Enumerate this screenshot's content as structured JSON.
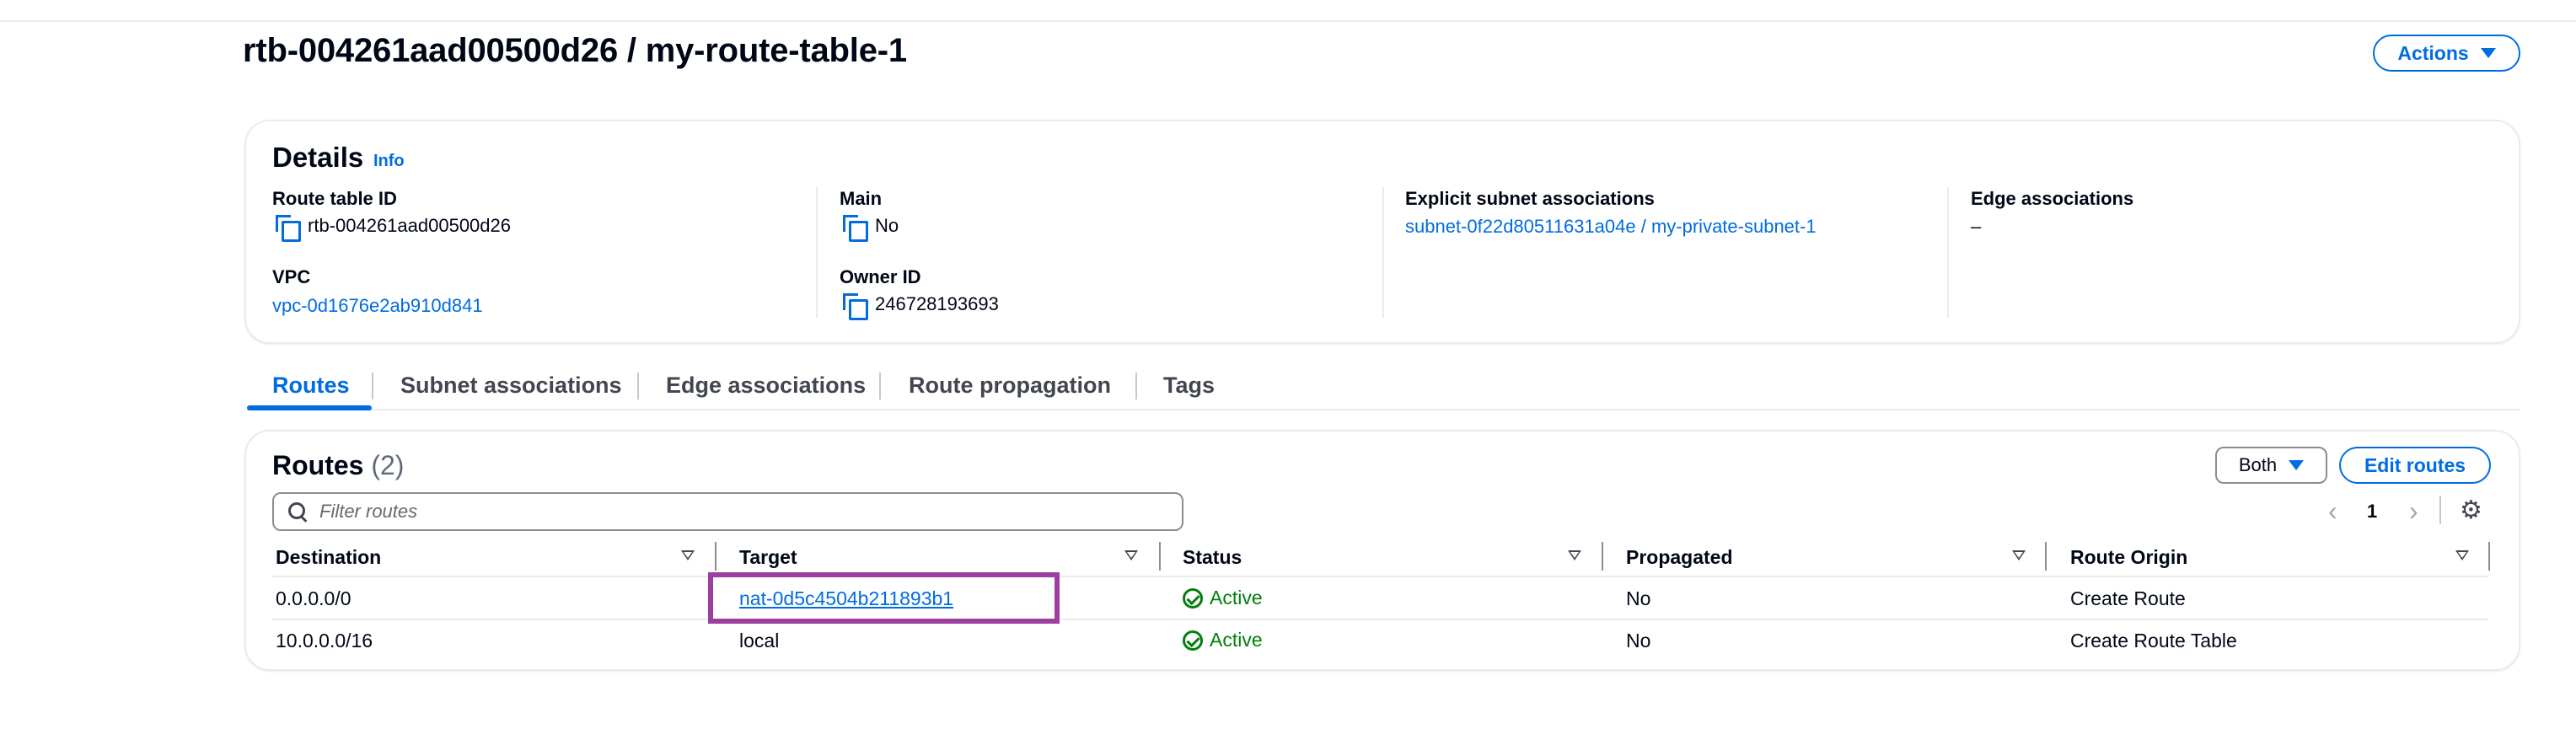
{
  "header": {
    "title": "rtb-004261aad00500d26 / my-route-table-1",
    "actions_label": "Actions"
  },
  "details": {
    "heading": "Details",
    "info_label": "Info",
    "route_table_id_label": "Route table ID",
    "route_table_id_value": "rtb-004261aad00500d26",
    "vpc_label": "VPC",
    "vpc_value": "vpc-0d1676e2ab910d841",
    "main_label": "Main",
    "main_value": "No",
    "owner_id_label": "Owner ID",
    "owner_id_value": "246728193693",
    "explicit_subnet_label": "Explicit subnet associations",
    "explicit_subnet_value": "subnet-0f22d80511631a04e / my-private-subnet-1",
    "edge_assoc_label": "Edge associations",
    "edge_assoc_value": "–"
  },
  "tabs": [
    {
      "label": "Routes",
      "active": true
    },
    {
      "label": "Subnet associations",
      "active": false
    },
    {
      "label": "Edge associations",
      "active": false
    },
    {
      "label": "Route propagation",
      "active": false
    },
    {
      "label": "Tags",
      "active": false
    }
  ],
  "routes": {
    "heading": "Routes",
    "count": "(2)",
    "filter_selected": "Both",
    "edit_label": "Edit routes",
    "search_placeholder": "Filter routes",
    "page_number": "1",
    "columns": [
      "Destination",
      "Target",
      "Status",
      "Propagated",
      "Route Origin"
    ],
    "rows": [
      {
        "destination": "0.0.0.0/0",
        "target": "nat-0d5c4504b211893b1",
        "status": "Active",
        "propagated": "No",
        "origin": "Create Route"
      },
      {
        "destination": "10.0.0.0/16",
        "target": "local",
        "status": "Active",
        "propagated": "No",
        "origin": "Create Route Table"
      }
    ]
  },
  "colors": {
    "link": "#006ce0",
    "success": "#037f0c",
    "highlight": "#9c3f9e"
  }
}
